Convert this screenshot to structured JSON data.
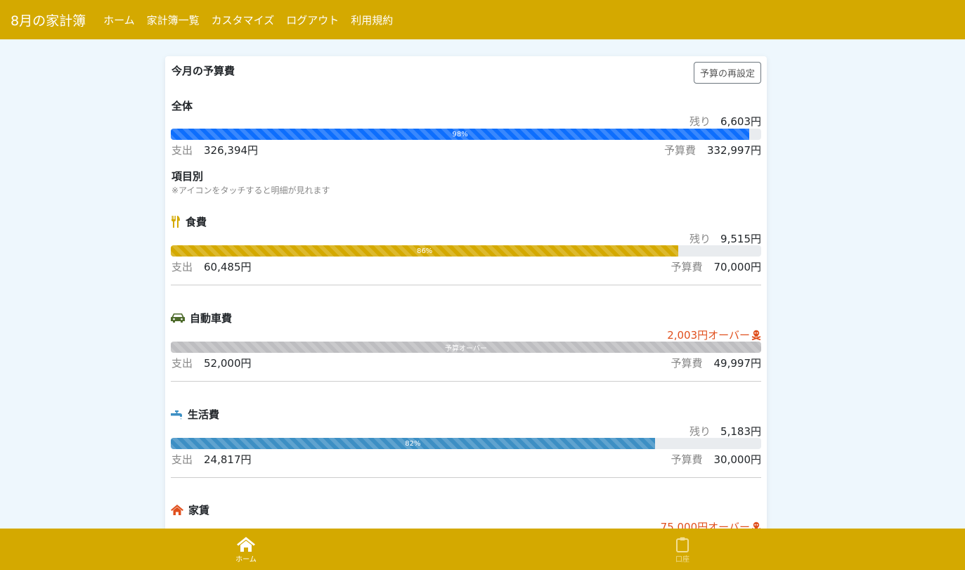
{
  "nav": {
    "brand": "8月の家計簿",
    "links": [
      "ホーム",
      "家計簿一覧",
      "カスタマイズ",
      "ログアウト",
      "利用規約"
    ]
  },
  "card": {
    "title": "今月の予算費",
    "reset_button": "予算の再設定"
  },
  "labels": {
    "remaining": "残り",
    "spent": "支出",
    "budget": "予算費"
  },
  "overall": {
    "heading": "全体",
    "remaining": "6,603円",
    "percent": 0.98,
    "percent_label": "98%",
    "spent": "326,394円",
    "budget": "332,997円",
    "color": "#0d6efd"
  },
  "by_item": {
    "heading": "項目別",
    "note": "※アイコンをタッチすると明細が見れます"
  },
  "categories": [
    {
      "name": "食費",
      "icon": "utensils-icon",
      "icon_color": "#d4a900",
      "remaining": "9,515円",
      "percent": 0.86,
      "percent_label": "86%",
      "spent": "60,485円",
      "budget": "70,000円",
      "color": "#d4a900",
      "over": false
    },
    {
      "name": "自動車費",
      "icon": "car-icon",
      "icon_color": "#4e6b2c",
      "over_text": "2,003円オーバー",
      "percent": 1.0,
      "percent_label": "予算オーバー",
      "spent": "52,000円",
      "budget": "49,997円",
      "color": "#bdbdc0",
      "over": true
    },
    {
      "name": "生活費",
      "icon": "faucet-icon",
      "icon_color": "#3c8fc4",
      "remaining": "5,183円",
      "percent": 0.82,
      "percent_label": "82%",
      "spent": "24,817円",
      "budget": "30,000円",
      "color": "#3c8fc4",
      "over": false
    },
    {
      "name": "家賃",
      "icon": "house-icon",
      "icon_color": "#e0501e",
      "over_text": "75,000円オーバー",
      "over": true
    }
  ],
  "over_color": "#e0501e",
  "bottom_nav": {
    "home": "ホーム",
    "account": "口座"
  }
}
